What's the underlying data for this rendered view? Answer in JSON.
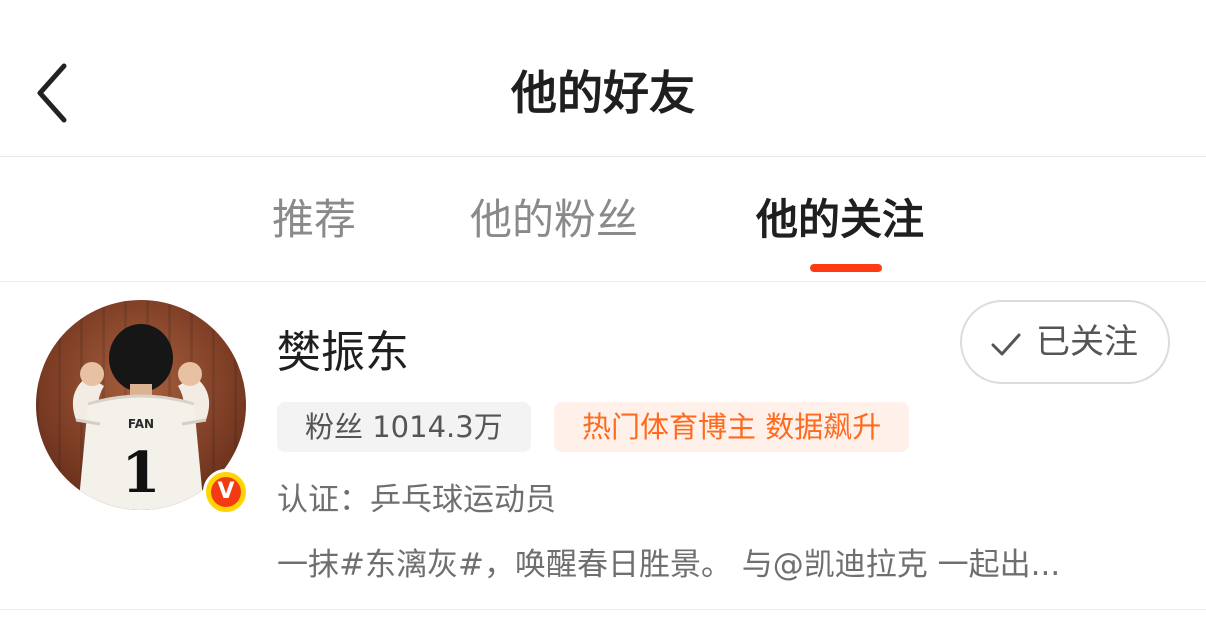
{
  "header": {
    "title": "他的好友",
    "back_icon": "chevron-left-icon"
  },
  "tabs": [
    {
      "label": "推荐",
      "active": false
    },
    {
      "label": "他的粉丝",
      "active": false
    },
    {
      "label": "他的关注",
      "active": true
    }
  ],
  "accent_color": "#ff3b13",
  "user": {
    "name": "樊振东",
    "avatar_text": "FAN",
    "avatar_number": "1",
    "verified_badge": "V",
    "fans_label": "粉丝 1014.3万",
    "hot_label": "热门体育博主 数据飙升",
    "verification": "认证：乒乓球运动员",
    "bio": "一抹#东漓灰#，唤醒春日胜景。 与@凯迪拉克 一起出...",
    "follow_button": {
      "label": "已关注",
      "icon": "check-icon"
    }
  }
}
